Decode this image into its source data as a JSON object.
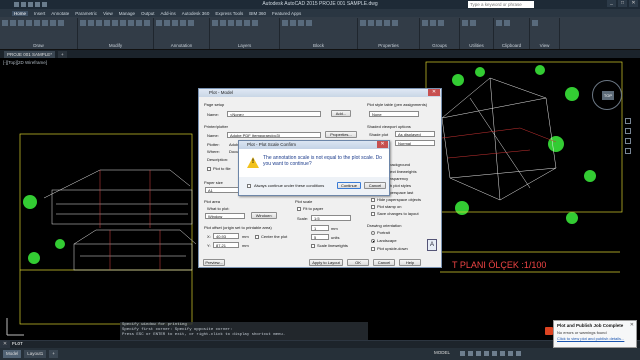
{
  "app": {
    "title": "Autodesk AutoCAD 2015   PROJE 001 SAMPLE.dwg",
    "search_placeholder": "Type a keyword or phrase",
    "win_controls": [
      "_",
      "□",
      "✕"
    ]
  },
  "menu_tabs": [
    "Home",
    "Insert",
    "Annotate",
    "Parametric",
    "View",
    "Manage",
    "Output",
    "Add-ins",
    "Autodesk 360",
    "Express Tools",
    "BIM 360",
    "Featured Apps"
  ],
  "ribbon_panels": [
    "Draw",
    "Modify",
    "Annotation",
    "Layers",
    "Block",
    "Properties",
    "Groups",
    "Utilities",
    "Clipboard",
    "View"
  ],
  "file_tabs": [
    "PROJE 001 SAMPLE*",
    "+"
  ],
  "viewport": {
    "label": "[-][Top][2D Wireframe]",
    "navcube_top": "TOP",
    "plan_label": "T PLANI ÖLÇEK :1/100"
  },
  "plot_dialog": {
    "title": "Plot - Model",
    "page_setup": {
      "group": "Page setup",
      "name_label": "Name:",
      "name_value": "<None>",
      "add_button": "Add..."
    },
    "printer": {
      "group": "Printer/plotter",
      "name_label": "Name:",
      "name_value": "Adobe PDF (temporary/pc3)",
      "properties_button": "Properties...",
      "plotter_label": "Plotter:",
      "plotter_value": "Adobe PDF Converter - Windows System Driver - by A...",
      "where_label": "Where:",
      "where_value": "Documents",
      "description_label": "Description:",
      "plot_to_file": "Plot to file"
    },
    "paper_size": {
      "group": "Paper size",
      "value": "A1"
    },
    "plot_area": {
      "group": "Plot area",
      "what_label": "What to plot:",
      "what_value": "Window",
      "window_button": "Window<"
    },
    "plot_offset": {
      "group": "Plot offset (origin set to printable area)",
      "x_label": "X:",
      "x_value": "40.93",
      "y_label": "Y:",
      "y_value": "87.21",
      "unit": "mm",
      "center": "Center the plot"
    },
    "plot_scale": {
      "group": "Plot scale",
      "fit": "Fit to paper",
      "scale_label": "Scale:",
      "scale_value": "1:5",
      "num_value": "1",
      "num_unit": "mm",
      "den_value": "5",
      "den_unit": "units",
      "lineweights": "Scale lineweights"
    },
    "style_table": {
      "group": "Plot style table (pen assignments)",
      "value": "None"
    },
    "shaded_viewport": {
      "group": "Shaded viewport options",
      "shade_label": "Shade plot",
      "shade_value": "As displayed",
      "quality_label": "Quality",
      "quality_value": "Normal"
    },
    "plot_options": {
      "group": "Plot options",
      "items": [
        "Plot in background",
        "Plot object lineweights",
        "Plot transparency",
        "Plot with plot styles",
        "Plot paperspace last",
        "Hide paperspace objects",
        "Plot stamp on",
        "Save changes to layout"
      ]
    },
    "orientation": {
      "group": "Drawing orientation",
      "items": [
        "Portrait",
        "Landscape",
        "Plot upside-down"
      ],
      "landscape_icon": "A"
    },
    "buttons": {
      "preview": "Preview...",
      "apply": "Apply to Layout",
      "ok": "OK",
      "cancel": "Cancel",
      "help": "Help"
    }
  },
  "confirm_dialog": {
    "title": "Plot - Plot Scale Confirm",
    "message": "The annotation scale is not equal to the plot scale. Do you want to continue?",
    "checkbox": "Always continue under these conditions",
    "continue_button": "Continue",
    "cancel_button": "Cancel"
  },
  "command_history": [
    "Specify window for printing",
    "Specify first corner: Specify opposite corner:",
    "Press ESC or ENTER to exit, or right-click to display shortcut menu."
  ],
  "command_line": {
    "prompt": "PLOT",
    "close": "✕"
  },
  "status_tabs": [
    "Model",
    "Layout1",
    "+"
  ],
  "status_model": "MODEL",
  "toast": {
    "title": "Plot and Publish Job Complete",
    "line1": "No errors or warnings found",
    "line2": "Click to view plot and publish details...",
    "close": "✕"
  }
}
